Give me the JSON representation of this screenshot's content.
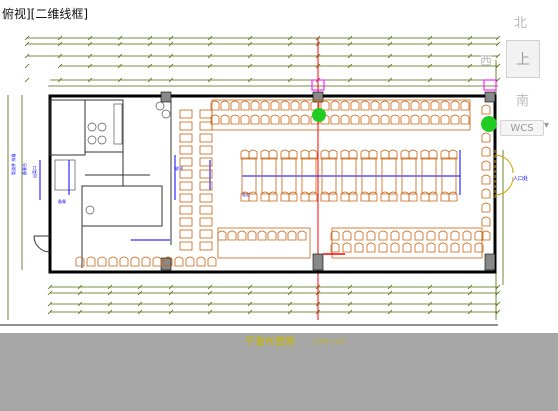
{
  "viewport": {
    "label": "俯视][二维线框]"
  },
  "drawing": {
    "caption": "平面布置图",
    "scale": "SCALE 1:100",
    "right_labels": [
      "入口处"
    ]
  },
  "viewcube": {
    "north": "北",
    "west": "西",
    "south": "南",
    "top_face": "上",
    "wcs": "WCS",
    "wcs_menu_icon": "triangle-down"
  },
  "colors": {
    "wall": "#000000",
    "furniture": "#c86414",
    "dimension": "#4a6a00",
    "accent_blue": "#0000ff",
    "axis_red": "#ff0000",
    "plant_green": "#00cc00",
    "column_magenta": "#ff00ff",
    "paper_bg": "#a7a7a7",
    "annotation_yellow": "#c8b900"
  }
}
